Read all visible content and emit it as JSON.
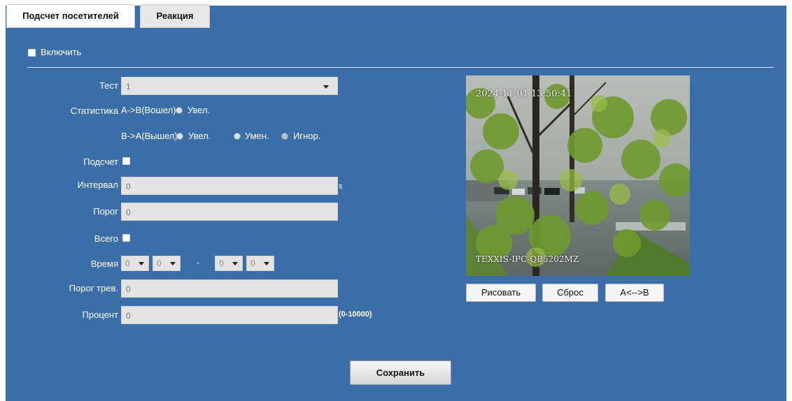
{
  "tabs": [
    {
      "label": "Подсчет посетителей",
      "active": true
    },
    {
      "label": "Реакция",
      "active": false
    }
  ],
  "enable": {
    "label": "Включить",
    "checked": false
  },
  "form": {
    "test": {
      "label": "Тест",
      "value": "1"
    },
    "statistics": {
      "label": "Статистика",
      "ab_label": "A->B(Вошел)",
      "ab_options": [
        "Увел."
      ],
      "ba_label": "B->A(Вышел)",
      "ba_options": [
        "Увел.",
        "Умен.",
        "Игнор."
      ]
    },
    "count": {
      "label": "Подсчет"
    },
    "interval": {
      "label": "Интервал",
      "value": "0",
      "unit": "s"
    },
    "threshold": {
      "label": "Порог",
      "value": "0"
    },
    "total": {
      "label": "Всего"
    },
    "time": {
      "label": "Время",
      "values": [
        "0",
        "0",
        "0",
        "0"
      ],
      "separator": "-"
    },
    "alarm_threshold": {
      "label": "Порог трев.",
      "value": "0"
    },
    "percent": {
      "label": "Процент",
      "value": "0",
      "range": "(0-10000)"
    }
  },
  "preview": {
    "timestamp": "2024-11-01 13:50:41",
    "camera_name": "TEXXIS-IPC-QB5202MZ"
  },
  "preview_buttons": {
    "draw": "Рисовать",
    "reset": "Сброс",
    "swap": "A<-->B"
  },
  "save_label": "Сохранить",
  "colors": {
    "panel": "#3b6ea8",
    "field": "#e3e3e3",
    "tab_active": "#ffffff"
  }
}
